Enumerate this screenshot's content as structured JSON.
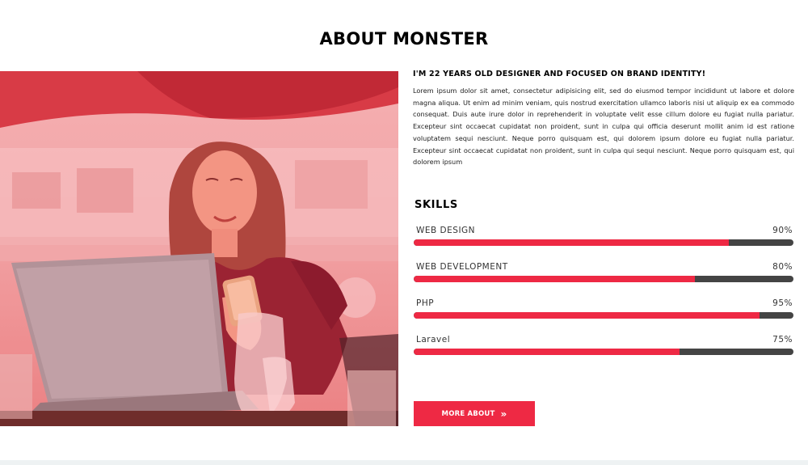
{
  "section": {
    "title": "ABOUT MONSTER"
  },
  "about": {
    "headline": "I'M 22 YEARS OLD DESIGNER AND FOCUSED ON BRAND IDENTITY!",
    "paragraph": "Lorem ipsum dolor sit amet, consectetur adipisicing elit, sed do eiusmod tempor incididunt ut labore et dolore magna aliqua. Ut enim ad minim veniam, quis nostrud exercitation ullamco laboris nisi ut aliquip ex ea commodo consequat. Duis aute irure dolor in reprehenderit in voluptate velit esse cillum dolore eu fugiat nulla pariatur. Excepteur sint occaecat cupidatat non proident, sunt in culpa qui officia deserunt mollit anim id est ratione voluptatem sequi nesciunt. Neque porro quisquam est, qui dolorem ipsum dolore eu fugiat nulla pariatur. Excepteur sint occaecat cupidatat non proident, sunt in culpa qui sequi nesciunt. Neque porro quisquam est, qui dolorem ipsum"
  },
  "skills": {
    "title": "SKILLS",
    "items": [
      {
        "name": "WEB DESIGN",
        "percent_label": "90%",
        "level": 0.83
      },
      {
        "name": "WEB DEVELOPMENT",
        "percent_label": "80%",
        "level": 0.74
      },
      {
        "name": "PHP",
        "percent_label": "95%",
        "level": 0.91
      },
      {
        "name": "Laravel",
        "percent_label": "75%",
        "level": 0.7
      }
    ]
  },
  "button": {
    "label": "MORE ABOUT",
    "icon": "double-chevron-right-icon"
  },
  "colors": {
    "accent": "#ee2944",
    "track": "#444444",
    "photo_tint": "#ea8a8a"
  }
}
